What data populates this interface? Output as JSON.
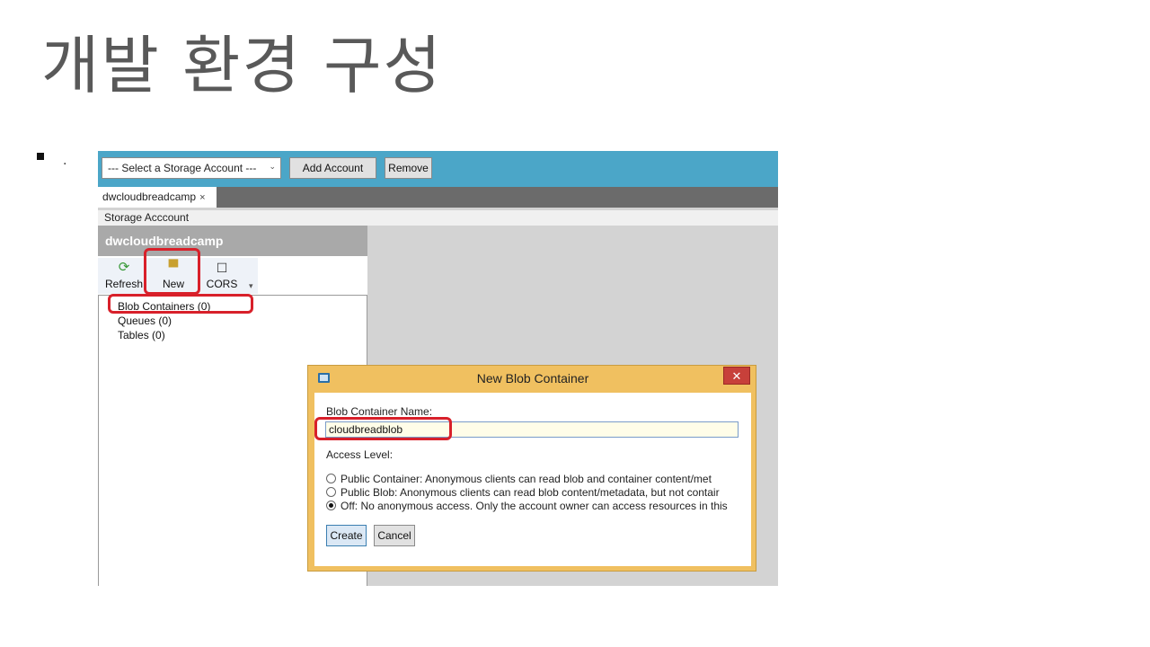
{
  "slide": {
    "title": "개발 환경 구성",
    "bullet_text": "."
  },
  "toolbar": {
    "account_select": "--- Select a Storage Account ---",
    "add_account_label": "Add Account",
    "remove_label": "Remove"
  },
  "tabs": [
    {
      "label": "dwcloudbreadcamp",
      "close": "×"
    }
  ],
  "breadcrumb": "Storage Acccount",
  "panel": {
    "header": "dwcloudbreadcamp",
    "ribbon": {
      "refresh_label": "Refresh",
      "new_label": "New",
      "cors_label": "CORS"
    },
    "tree": [
      {
        "label": "Blob Containers (0)"
      },
      {
        "label": "Queues (0)"
      },
      {
        "label": "Tables (0)"
      }
    ]
  },
  "dialog": {
    "title": "New Blob Container",
    "close": "✕",
    "name_label": "Blob Container Name:",
    "name_value": "cloudbreadblob",
    "access_label": "Access Level:",
    "options": [
      {
        "label": "Public Container: Anonymous clients can read blob and container content/met",
        "selected": false
      },
      {
        "label": "Public Blob: Anonymous clients can read blob content/metadata, but not contair",
        "selected": false
      },
      {
        "label": "Off: No anonymous access. Only the account owner can access resources in this",
        "selected": true
      }
    ],
    "create_label": "Create",
    "cancel_label": "Cancel"
  },
  "colors": {
    "toolbar_bg": "#4ba6c8",
    "highlight": "#d8202a",
    "dialog_frame": "#f0c060"
  }
}
